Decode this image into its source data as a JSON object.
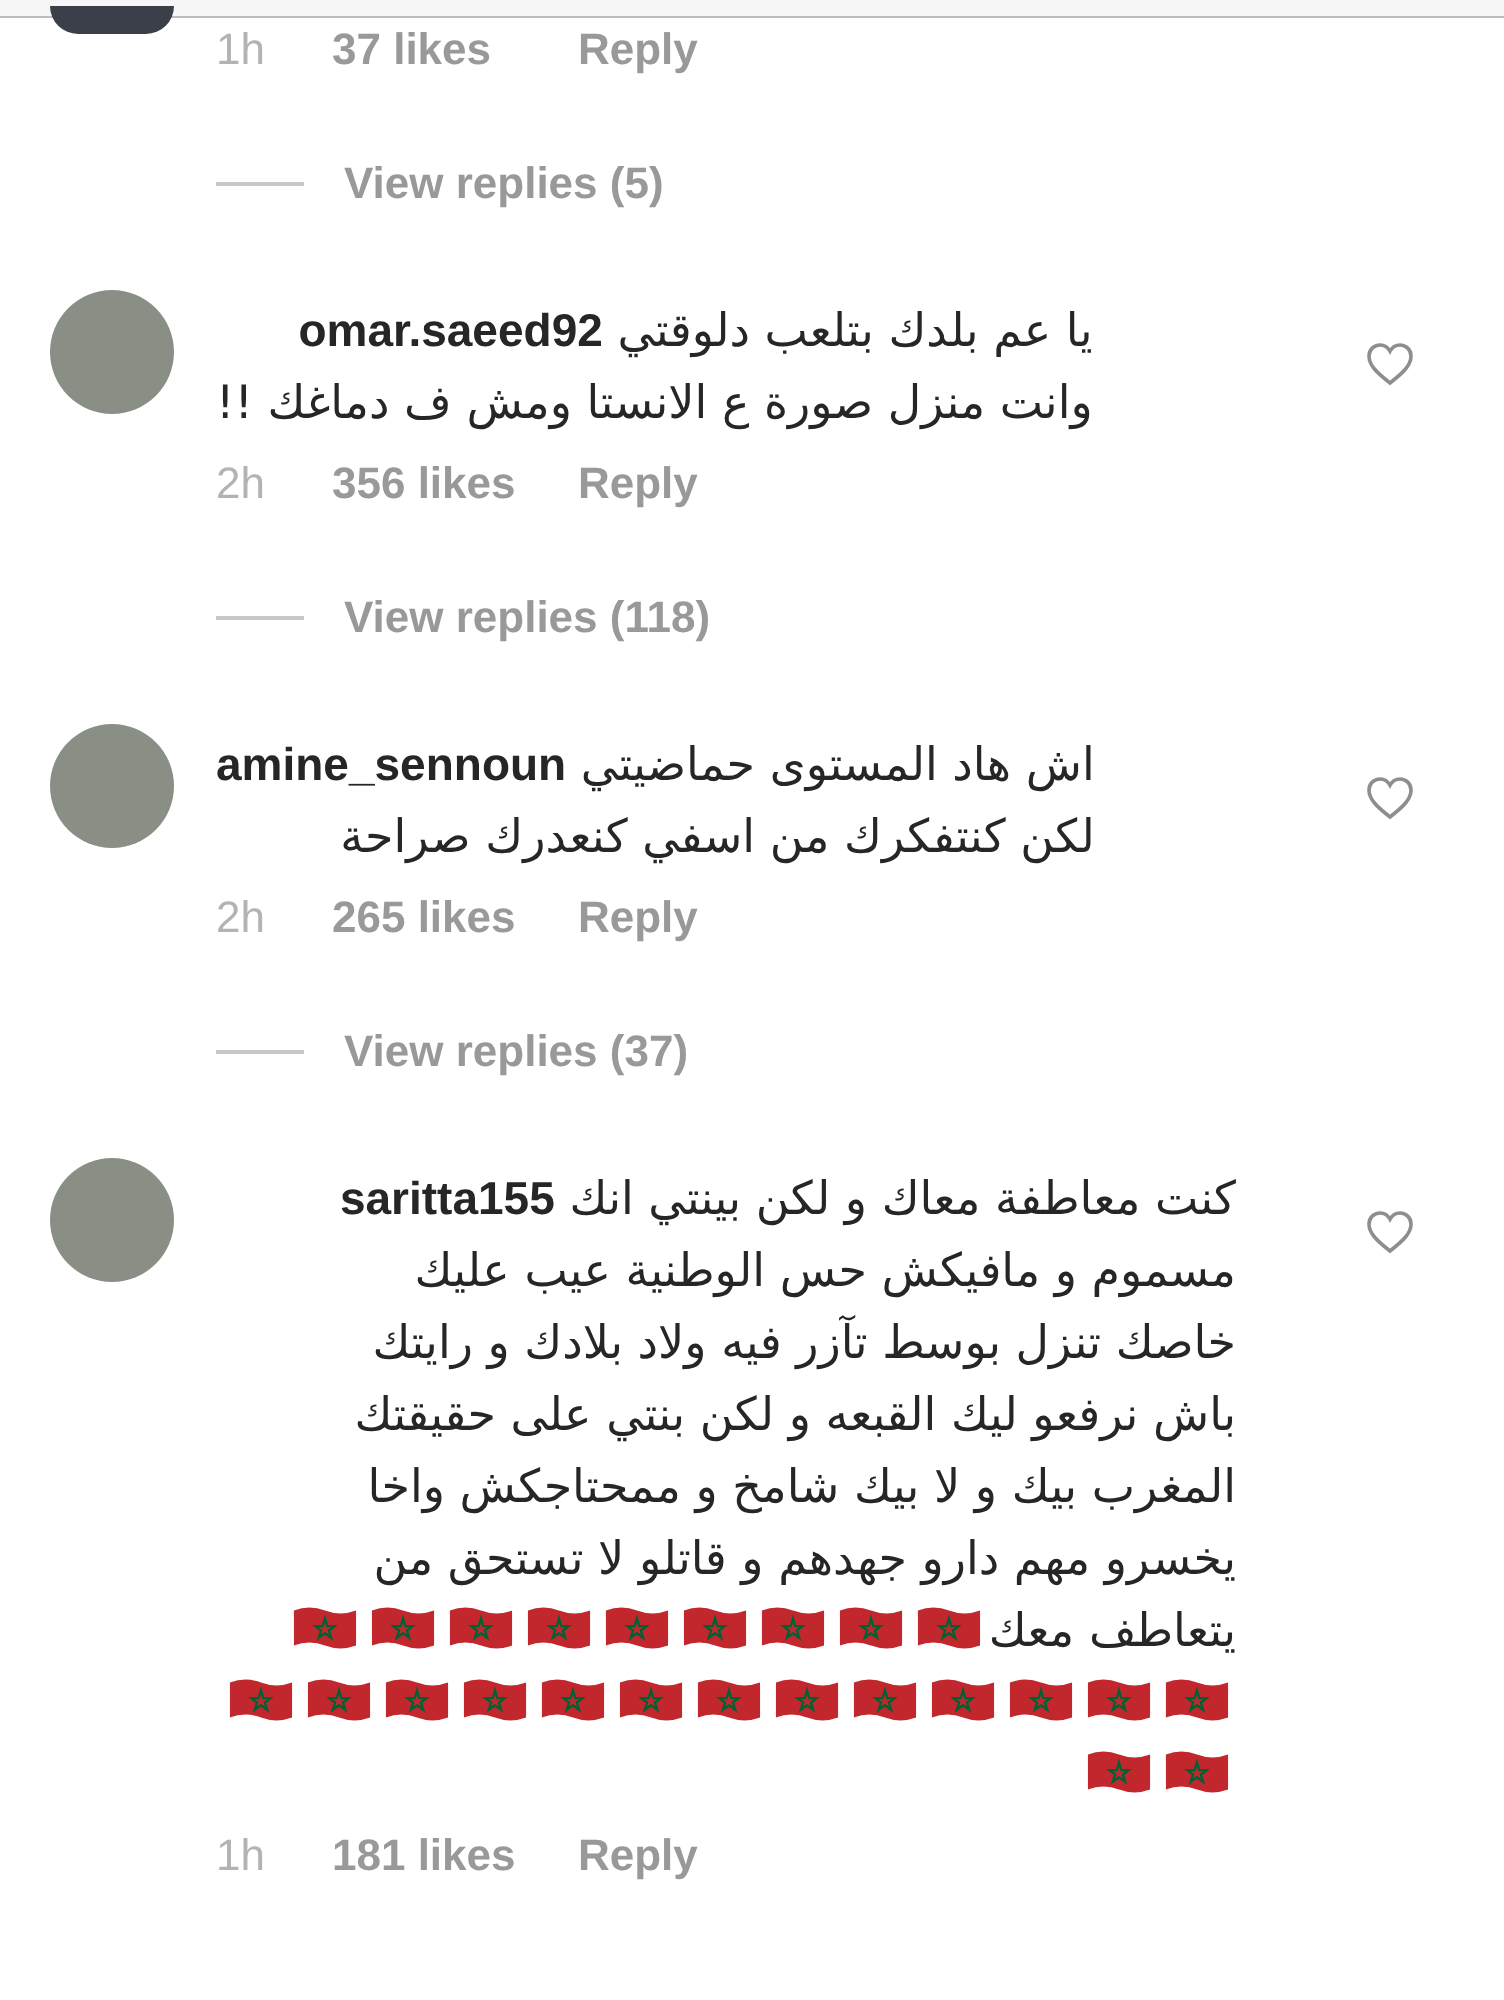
{
  "comments": [
    {
      "kind": "partial",
      "time": "1h",
      "likes": "37 likes",
      "reply": "Reply",
      "view_replies": "View replies (5)"
    },
    {
      "kind": "full",
      "username": "omar.saeed92",
      "lines": [
        "يا عم بلدك بتلعب دلوقتي",
        "وانت منزل صورة ع الانستا ومش ف دماغك !!"
      ],
      "time": "2h",
      "likes": "356 likes",
      "reply": "Reply",
      "view_replies": "View replies (118)",
      "liked": false
    },
    {
      "kind": "full",
      "username": "amine_sennoun",
      "lines": [
        "اش هاد المستوى حماضيتي",
        "لكن كنتفكرك من اسفي كنعدرك صراحة"
      ],
      "time": "2h",
      "likes": "265 likes",
      "reply": "Reply",
      "view_replies": "View replies (37)",
      "liked": false
    },
    {
      "kind": "full",
      "username": "saritta155",
      "lines": [
        "كنت معاطفة معاك و لكن بينتي انك",
        "مسموم و مافيكش حس الوطنية عيب عليك",
        "خاصك تنزل بوسط تآزر فيه ولاد بلادك و رايتك",
        "باش نرفعو ليك القبعه و لكن بنتي على حقيقتك",
        "المغرب بيك و لا بيك شامخ و ممحتاجكش واخا",
        "يخسرو مهم دارو جهدهم و قاتلو لا تستحق من",
        "يتعاطف معك"
      ],
      "flags": [
        {
          "kind": "morocco"
        },
        {
          "kind": "morocco"
        },
        {
          "kind": "morocco"
        },
        {
          "kind": "morocco"
        },
        {
          "kind": "morocco"
        },
        {
          "kind": "morocco"
        },
        {
          "kind": "morocco"
        },
        {
          "kind": "morocco"
        },
        {
          "kind": "morocco"
        },
        {
          "kind": "morocco"
        },
        {
          "kind": "morocco"
        },
        {
          "kind": "morocco"
        },
        {
          "kind": "morocco"
        },
        {
          "kind": "morocco"
        },
        {
          "kind": "morocco"
        },
        {
          "kind": "morocco"
        },
        {
          "kind": "morocco"
        },
        {
          "kind": "morocco"
        },
        {
          "kind": "morocco"
        },
        {
          "kind": "morocco"
        },
        {
          "kind": "morocco"
        },
        {
          "kind": "morocco"
        },
        {
          "kind": "morocco"
        },
        {
          "kind": "morocco"
        }
      ],
      "time": "1h",
      "likes": "181 likes",
      "reply": "Reply",
      "liked": false
    }
  ]
}
